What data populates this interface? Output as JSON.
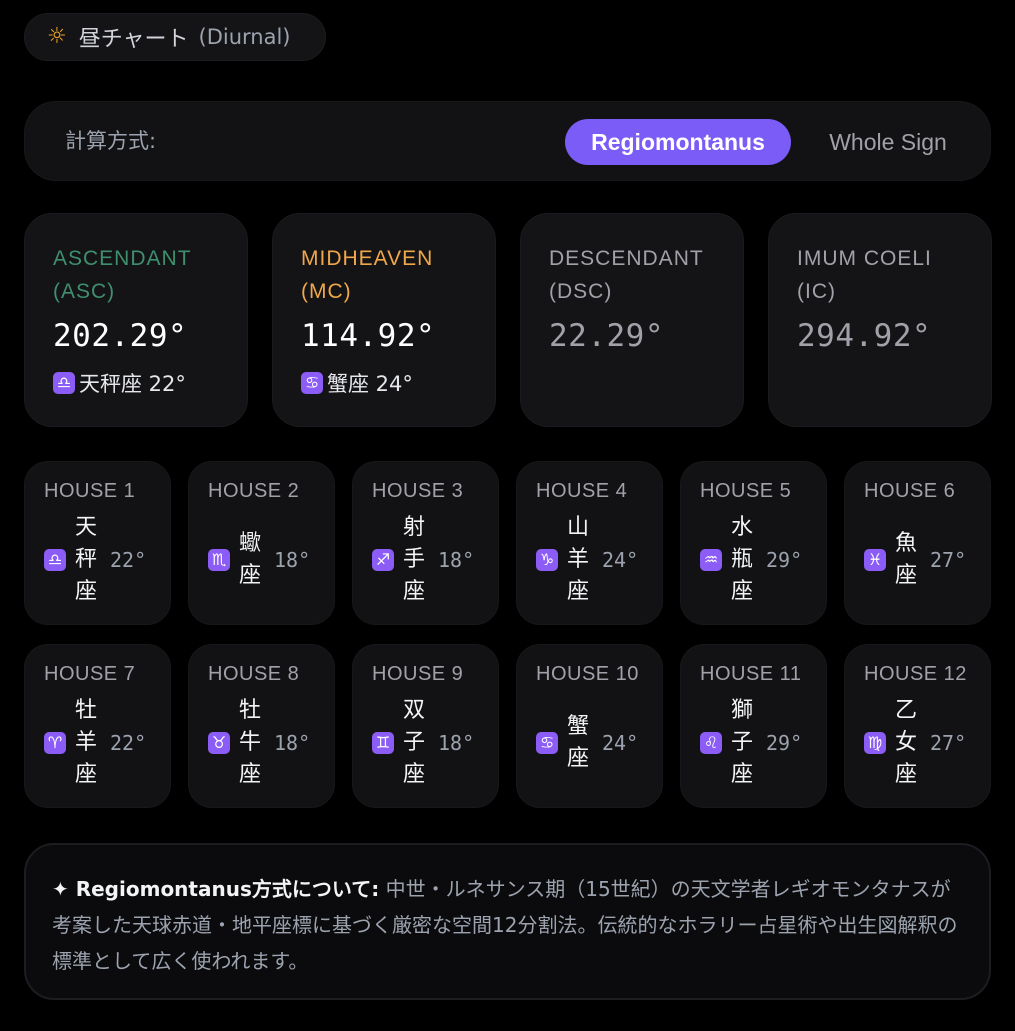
{
  "chart_type": {
    "icon": "sun-icon",
    "label": "昼チャート",
    "sub": "(Diurnal)",
    "icon_color": "#f5a524"
  },
  "method": {
    "label": "計算方式:",
    "options": [
      {
        "label": "Regiomontanus",
        "active": true
      },
      {
        "label": "Whole Sign",
        "active": false
      }
    ],
    "accent": "#7c5cf6"
  },
  "angles": [
    {
      "label": "ASCENDANT (ASC)",
      "value": "202.29°",
      "glyph": "♎",
      "sign": "天秤座 22°",
      "color": "#3f8f6f"
    },
    {
      "label": "MIDHEAVEN (MC)",
      "value": "114.92°",
      "glyph": "♋",
      "sign": "蟹座 24°",
      "color": "#f0a74a"
    },
    {
      "label": "DESCENDANT (DSC)",
      "value": "22.29°",
      "glyph": "",
      "sign": "",
      "color": "#a1a1aa"
    },
    {
      "label": "IMUM COELI (IC)",
      "value": "294.92°",
      "glyph": "",
      "sign": "",
      "color": "#a1a1aa"
    }
  ],
  "houses": [
    {
      "label": "HOUSE 1",
      "glyph": "♎",
      "sign": "天秤座",
      "degree": "22°"
    },
    {
      "label": "HOUSE 2",
      "glyph": "♏",
      "sign": "蠍座",
      "degree": "18°"
    },
    {
      "label": "HOUSE 3",
      "glyph": "♐",
      "sign": "射手座",
      "degree": "18°"
    },
    {
      "label": "HOUSE 4",
      "glyph": "♑",
      "sign": "山羊座",
      "degree": "24°"
    },
    {
      "label": "HOUSE 5",
      "glyph": "♒",
      "sign": "水瓶座",
      "degree": "29°"
    },
    {
      "label": "HOUSE 6",
      "glyph": "♓",
      "sign": "魚座",
      "degree": "27°"
    },
    {
      "label": "HOUSE 7",
      "glyph": "♈",
      "sign": "牡羊座",
      "degree": "22°"
    },
    {
      "label": "HOUSE 8",
      "glyph": "♉",
      "sign": "牡牛座",
      "degree": "18°"
    },
    {
      "label": "HOUSE 9",
      "glyph": "♊",
      "sign": "双子座",
      "degree": "18°"
    },
    {
      "label": "HOUSE 10",
      "glyph": "♋",
      "sign": "蟹座",
      "degree": "24°"
    },
    {
      "label": "HOUSE 11",
      "glyph": "♌",
      "sign": "獅子座",
      "degree": "29°"
    },
    {
      "label": "HOUSE 12",
      "glyph": "♍",
      "sign": "乙女座",
      "degree": "27°"
    }
  ],
  "info": {
    "lead": "✦ Regiomontanus方式について:",
    "text": "中世・ルネサンス期（15世紀）の天文学者レギオモンタナスが考案した天球赤道・地平座標に基づく厳密な空間12分割法。伝統的なホラリー占星術や出生図解釈の標準として広く使われます。"
  }
}
